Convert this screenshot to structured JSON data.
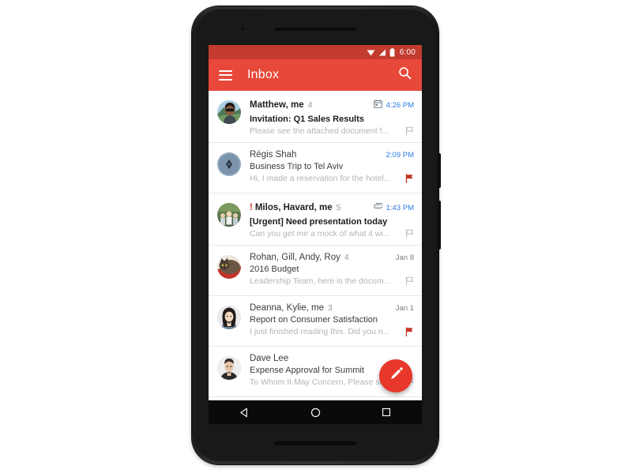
{
  "device": {
    "name": "android-phone",
    "earpiece": "earpiece-speaker",
    "front_camera": "front-camera",
    "power_button": "power-button",
    "volume_button": "volume-button",
    "bottom_speaker": "bottom-speaker"
  },
  "colors": {
    "status_bar": "#c23b2e",
    "toolbar": "#e8483a",
    "fab": "#e8382b",
    "unread_time": "#2a7ae2",
    "flag_active": "#d93025",
    "importance": "#d93025"
  },
  "status_bar": {
    "time": "6:00",
    "icons": [
      "wifi-icon",
      "signal-icon",
      "battery-icon"
    ]
  },
  "toolbar": {
    "menu_label": "Menu",
    "title": "Inbox",
    "search_label": "Search"
  },
  "emails": [
    {
      "senders": "Matthew, me",
      "count": "4",
      "subject": "Invitation: Q1 Sales Results",
      "snippet": "Please see the attached document f...",
      "time": "4:26 PM",
      "unread": true,
      "important": false,
      "attachment_icon": "calendar-icon",
      "flag": "flag-outline-icon",
      "avatar": "avatar-man-sunglasses"
    },
    {
      "senders": "Régis Shah",
      "count": "",
      "subject": "Business Trip to Tel Aviv",
      "snippet": "Hi, I made a reservation for the hotel...",
      "time": "2:09 PM",
      "unread": false,
      "important": false,
      "attachment_icon": "",
      "flag": "flag-filled-icon",
      "avatar": "avatar-blue-abstract"
    },
    {
      "senders": "Milos, Havard, me",
      "count": "5",
      "subject": "[Urgent] Need presentation today",
      "snippet": "Can you get me a mock of what it wi...",
      "time": "1:43 PM",
      "unread": true,
      "important": true,
      "attachment_icon": "paperclip-icon",
      "flag": "flag-outline-icon",
      "avatar": "avatar-group-photo"
    },
    {
      "senders": "Rohan, Gill, Andy, Roy",
      "count": "4",
      "subject": "2016 Budget",
      "snippet": "Leadership Team, here is the docum...",
      "time": "Jan 8",
      "unread": false,
      "important": false,
      "attachment_icon": "",
      "flag": "flag-outline-icon",
      "avatar": "avatar-cat"
    },
    {
      "senders": "Deanna, Kylie, me",
      "count": "3",
      "subject": "Report on Consumer Satisfaction",
      "snippet": "I just finished reading this. Did you n...",
      "time": "Jan 1",
      "unread": false,
      "important": false,
      "attachment_icon": "",
      "flag": "flag-filled-icon",
      "avatar": "avatar-woman"
    },
    {
      "senders": "Dave Lee",
      "count": "",
      "subject": "Expense Approval for Summit",
      "snippet": "To Whom It May Concern, Please see",
      "time": "",
      "unread": false,
      "important": false,
      "attachment_icon": "",
      "flag": "flag-outline-icon",
      "avatar": "avatar-man-short-hair"
    }
  ],
  "fab": {
    "label": "Compose",
    "icon": "pencil-icon"
  },
  "nav_bar": {
    "back": "back-button",
    "home": "home-button",
    "recents": "recents-button"
  }
}
